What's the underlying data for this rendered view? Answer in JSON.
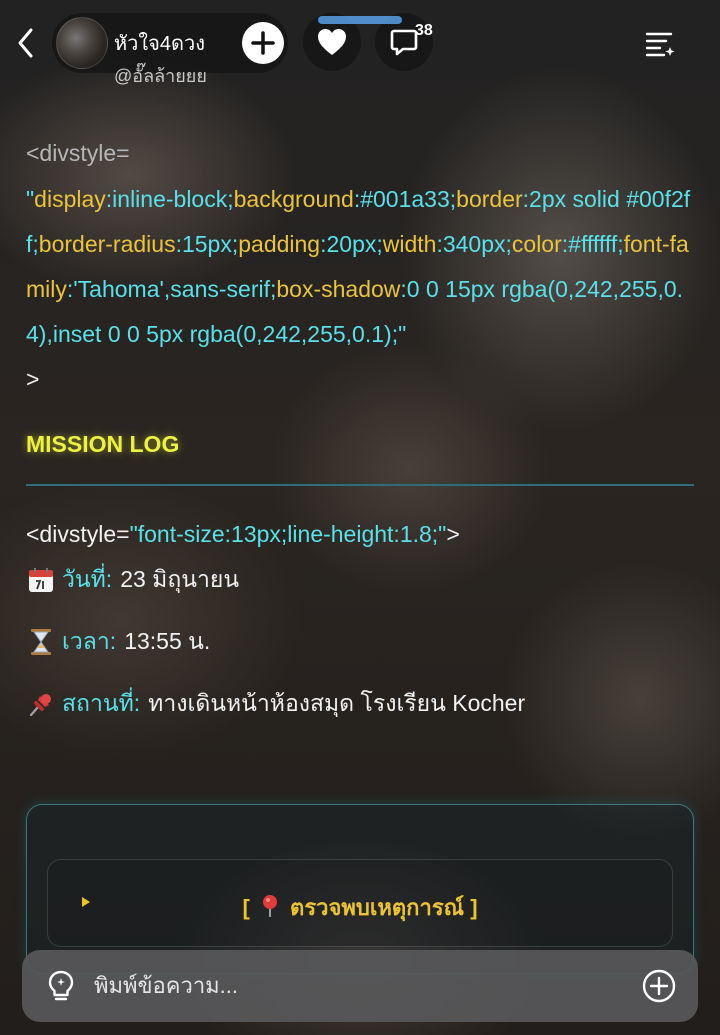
{
  "header": {
    "profile_name": "หัวใจ4ดวง",
    "profile_handle": "@อั๊ลล้ายยย",
    "comment_count": "38",
    "reading_progress": 0.12
  },
  "content": {
    "code_open": "<divstyle=",
    "style_tokens": [
      {
        "t": "\"",
        "k": "val"
      },
      {
        "t": "display",
        "k": "prop"
      },
      {
        "t": ":",
        "k": "val"
      },
      {
        "t": "inline-block",
        "k": "val"
      },
      {
        "t": ";",
        "k": "val"
      },
      {
        "t": "background",
        "k": "prop"
      },
      {
        "t": ":",
        "k": "val"
      },
      {
        "t": "#001a33",
        "k": "val"
      },
      {
        "t": ";",
        "k": "val"
      },
      {
        "t": "border",
        "k": "prop"
      },
      {
        "t": ":",
        "k": "val"
      },
      {
        "t": "2px solid #00f2ff",
        "k": "val"
      },
      {
        "t": ";",
        "k": "val"
      },
      {
        "t": "border-radius",
        "k": "prop"
      },
      {
        "t": ":",
        "k": "val"
      },
      {
        "t": "15px",
        "k": "val"
      },
      {
        "t": ";",
        "k": "val"
      },
      {
        "t": "padding",
        "k": "prop"
      },
      {
        "t": ":",
        "k": "val"
      },
      {
        "t": "20px",
        "k": "val"
      },
      {
        "t": ";",
        "k": "val"
      },
      {
        "t": "width",
        "k": "prop"
      },
      {
        "t": ":",
        "k": "val"
      },
      {
        "t": "340px",
        "k": "val"
      },
      {
        "t": ";",
        "k": "val"
      },
      {
        "t": "color",
        "k": "prop"
      },
      {
        "t": ":",
        "k": "val"
      },
      {
        "t": "#ffffff",
        "k": "val"
      },
      {
        "t": ";",
        "k": "val"
      },
      {
        "t": "font-family",
        "k": "prop"
      },
      {
        "t": ":",
        "k": "val"
      },
      {
        "t": "'Tahoma',sans-serif",
        "k": "val"
      },
      {
        "t": ";",
        "k": "val"
      },
      {
        "t": "box-shadow",
        "k": "prop"
      },
      {
        "t": ":",
        "k": "val"
      },
      {
        "t": "0 0 15px rgba(0,242,255,0.4),inset 0 0 5px rgba(0,242,255,0.1)",
        "k": "val"
      },
      {
        "t": ";",
        "k": "val"
      },
      {
        "t": "\"",
        "k": "val"
      }
    ],
    "code_close": ">",
    "mission_title": "MISSION LOG",
    "code_line2_prefix": "<divstyle=",
    "code_line2_style": "\"font-size:13px;line-height:1.8;\"",
    "code_line2_suffix": ">",
    "date_label": "วันที่:",
    "date_value": "23 มิถุนายน",
    "time_label": "เวลา:",
    "time_value": "13:55 น.",
    "place_label": "สถานที่:",
    "place_value": "ทางเดินหน้าห้องสมุด โรงเรียน Kocher",
    "section_open": "[",
    "section_title": "ตรวจพบเหตุการณ์",
    "section_close": "]"
  },
  "composer": {
    "placeholder": "พิมพ์ข้อความ..."
  },
  "icons": {
    "back": "chevron-left-icon",
    "follow": "plus-icon",
    "like": "heart-icon",
    "comment": "comment-bubble-icon",
    "menu": "list-menu-icon",
    "calendar": "calendar-emoji-icon",
    "hourglass": "hourglass-emoji-icon",
    "pin": "pushpin-emoji-icon",
    "toggle": "triangle-right-icon",
    "bulb": "lightbulb-icon",
    "add": "plus-circle-icon"
  },
  "colors": {
    "prop": "#eac43a",
    "value": "#58e1e9",
    "mission_title": "#ecf23d",
    "section_title": "#ecc430"
  }
}
